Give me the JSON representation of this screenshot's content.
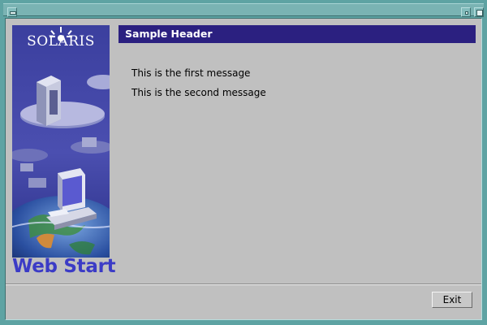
{
  "brand": {
    "name": "SOLARIS",
    "product": "Web Start"
  },
  "header": {
    "title": "Sample Header"
  },
  "messages": [
    "This is the first message",
    "This is the second message"
  ],
  "buttons": {
    "exit": "Exit"
  },
  "colors": {
    "window_frame": "#5ea3a3",
    "client_bg": "#c0c0c0",
    "header_bg": "#2b2080",
    "brand_text": "#3b3bc6"
  },
  "icons": {
    "window_menu": "window-menu-icon",
    "minimize": "minimize-icon",
    "maximize": "maximize-icon"
  }
}
